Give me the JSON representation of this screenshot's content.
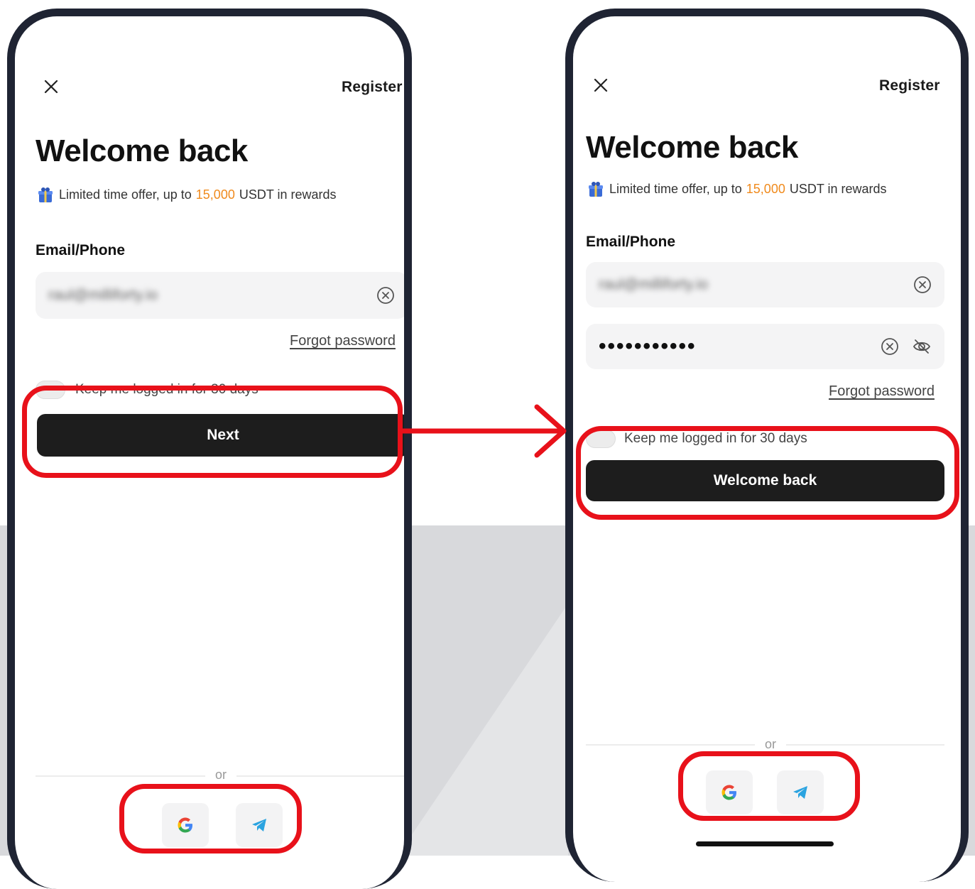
{
  "colors": {
    "accent_orange": "#f08a1c",
    "highlight_red": "#e8111a",
    "button_dark": "#1d1d1d",
    "phone_frame": "#1f2433"
  },
  "login_step1": {
    "register_link": "Register",
    "title": "Welcome back",
    "promo": {
      "prefix": "Limited time offer, up to",
      "amount": "15,000",
      "suffix": "USDT in rewards"
    },
    "email_label": "Email/Phone",
    "email_value": "raul@milliforty.io",
    "forgot_password": "Forgot password",
    "keep_logged_in": "Keep me logged in for 30 days",
    "primary_button": "Next",
    "or_text": "or",
    "social_icons": [
      "google-icon",
      "telegram-icon"
    ]
  },
  "login_step2": {
    "register_link": "Register",
    "title": "Welcome back",
    "promo": {
      "prefix": "Limited time offer, up to",
      "amount": "15,000",
      "suffix": "USDT in rewards"
    },
    "email_label": "Email/Phone",
    "email_value": "raul@milliforty.io",
    "password_value": "•••••••••••",
    "forgot_password": "Forgot password",
    "keep_logged_in": "Keep me logged in for 30 days",
    "primary_button": "Welcome back",
    "or_text": "or",
    "social_icons": [
      "google-icon",
      "telegram-icon"
    ]
  }
}
